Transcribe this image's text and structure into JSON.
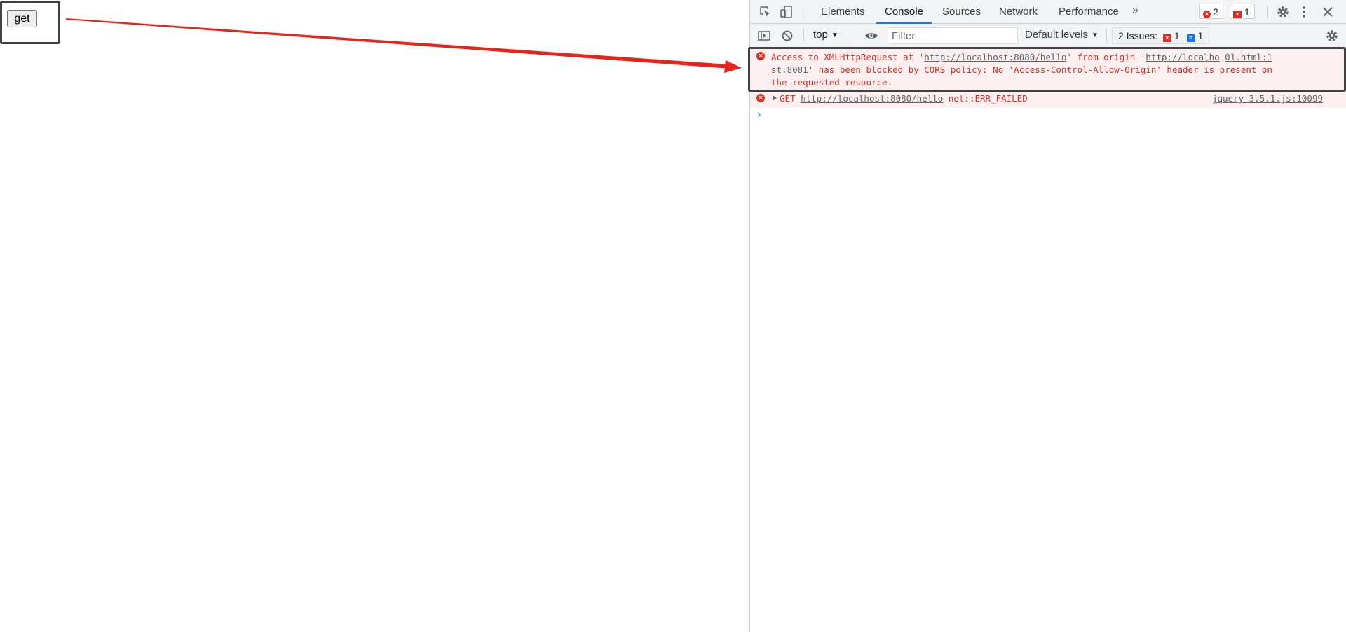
{
  "page": {
    "get_button_label": "get"
  },
  "devtools": {
    "tabs": [
      {
        "label": "Elements",
        "active": false
      },
      {
        "label": "Console",
        "active": true
      },
      {
        "label": "Sources",
        "active": false
      },
      {
        "label": "Network",
        "active": false
      },
      {
        "label": "Performance",
        "active": false
      }
    ],
    "more_tabs_glyph": "»",
    "error_count": "2",
    "issue_error_count": "1",
    "toolbar": {
      "context": "top",
      "filter_placeholder": "Filter",
      "levels": "Default levels",
      "issues_label": "2 Issues:",
      "issues_errors": "1",
      "issues_info": "1"
    },
    "messages": [
      {
        "level": "error",
        "part1": "Access to XMLHttpRequest at '",
        "url1": "http://localhost:8080/hello",
        "part2": "' from origin '",
        "url2a": "http://localho",
        "source": "01.html:1",
        "url2b": "st:8081",
        "part3": "' has been blocked by CORS policy: No 'Access-Control-Allow-Origin' header is present on",
        "part4": "the requested resource."
      },
      {
        "level": "error",
        "method": "GET",
        "url": "http://localhost:8080/hello",
        "error": "net::ERR_FAILED",
        "source": "jquery-3.5.1.js:10099"
      }
    ],
    "prompt_glyph": "›"
  },
  "colors": {
    "error": "#d93025",
    "error_bg": "#fcefef",
    "accent": "#1a73e8",
    "annotation_arrow": "#e8231a"
  },
  "icons": [
    "inspect-element-icon",
    "device-toolbar-icon",
    "settings-gear-icon",
    "kebab-menu-icon",
    "close-icon",
    "sidebar-toggle-icon",
    "clear-console-icon",
    "live-expression-eye-icon",
    "console-settings-gear-icon"
  ]
}
